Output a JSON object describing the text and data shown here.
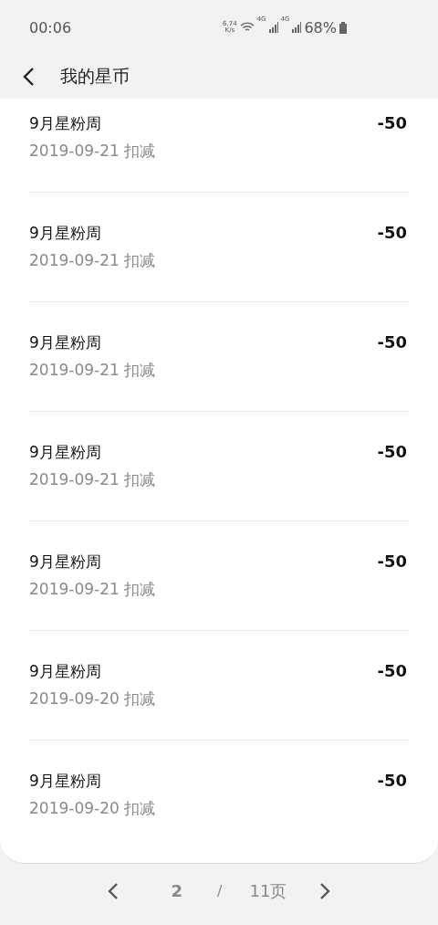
{
  "status_bar": {
    "time": "00:06",
    "net_speed": "6.74",
    "net_unit": "K/s",
    "networks": [
      "4G",
      "4G"
    ],
    "battery": "68%"
  },
  "header": {
    "title": "我的星币"
  },
  "records": [
    {
      "title": "9月星粉周",
      "date": "2019-09-21 扣减",
      "amount": "-50"
    },
    {
      "title": "9月星粉周",
      "date": "2019-09-21 扣减",
      "amount": "-50"
    },
    {
      "title": "9月星粉周",
      "date": "2019-09-21 扣减",
      "amount": "-50"
    },
    {
      "title": "9月星粉周",
      "date": "2019-09-21 扣减",
      "amount": "-50"
    },
    {
      "title": "9月星粉周",
      "date": "2019-09-21 扣减",
      "amount": "-50"
    },
    {
      "title": "9月星粉周",
      "date": "2019-09-20 扣减",
      "amount": "-50"
    },
    {
      "title": "9月星粉周",
      "date": "2019-09-20 扣减",
      "amount": "-50"
    }
  ],
  "pagination": {
    "current": "2",
    "separator": "/",
    "total": "11页"
  }
}
